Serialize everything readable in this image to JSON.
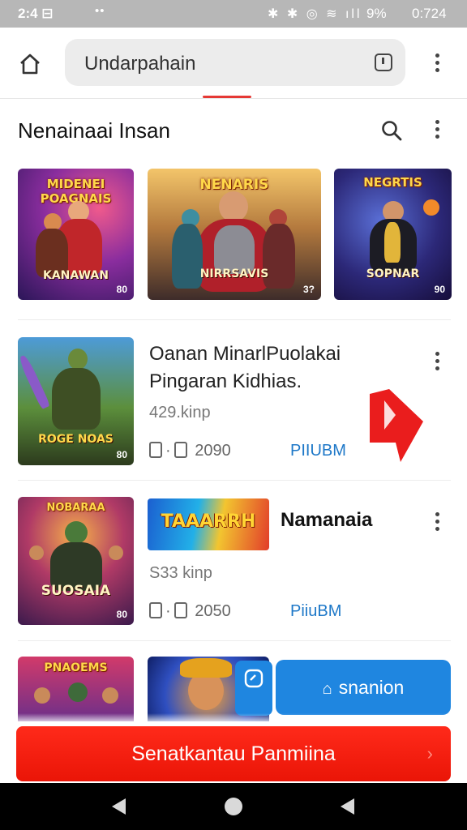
{
  "status_bar": {
    "time": "2:4 ⊟",
    "icons": "✱ ✱ ◎ ≋ ıll",
    "battery": "9%",
    "clock_right": "0:724"
  },
  "browser": {
    "url": "Undarpahain"
  },
  "section": {
    "title": "Nenainaai Insan"
  },
  "top_thumbnails": [
    {
      "title": "MIDENEI POAGNAIS",
      "bottom": "KANAWAN",
      "badge": "80"
    },
    {
      "title": "NENARIS",
      "bottom": "NIRRSAVIS",
      "badge": "3?"
    },
    {
      "title": "NEGRTIS",
      "bottom": "SOPNAR",
      "badge": "90"
    }
  ],
  "rows": [
    {
      "title_line1": "Oanan MinarlPuolakai",
      "title_line2": "Pingaran Kidhias.",
      "size": "429.kinp",
      "meta": "2090",
      "action": "PIIUBM",
      "thumb_label": "ROGE NOAS",
      "thumb_badge": "80"
    },
    {
      "banner": "TAAARRH",
      "name": "Namanaia",
      "size": "S33 kinp",
      "meta": "2050",
      "action": "PiiuBM",
      "thumb_title": "NOBARAA",
      "thumb_label": "SUOSAIA",
      "thumb_badge": "80"
    }
  ],
  "partial_row": {
    "thumb_title": "PNAOEMS"
  },
  "fab": {
    "label": "snanion",
    "icon": "house-icon"
  },
  "cta": {
    "label": "Senatkantau Panmiina",
    "chevron": "›"
  },
  "colors": {
    "accent_red": "#ea1507",
    "accent_blue": "#1f86e0",
    "link_blue": "#1e78c8"
  }
}
